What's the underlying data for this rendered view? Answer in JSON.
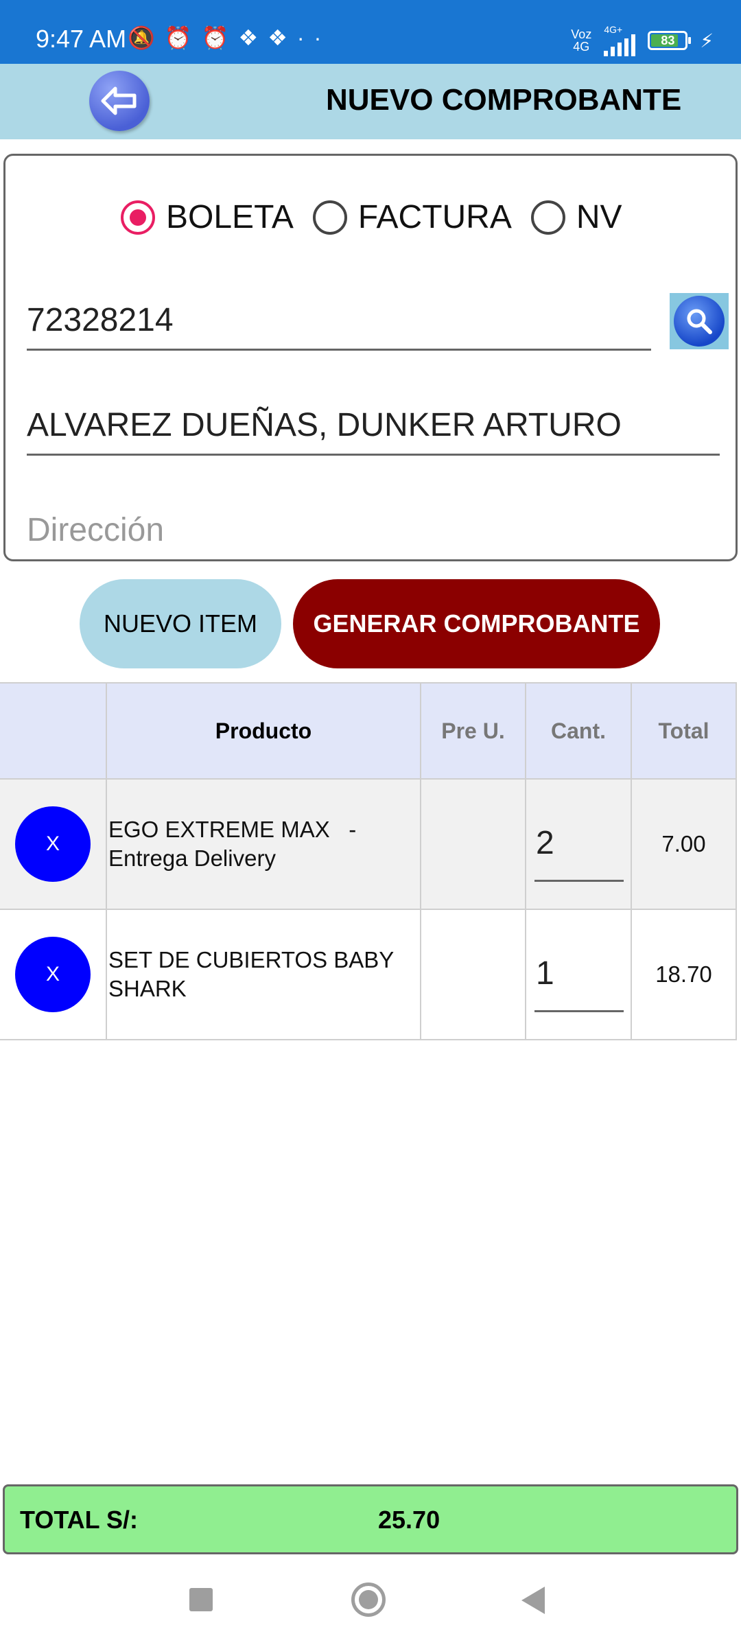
{
  "status_bar": {
    "time": "9:47 AM",
    "icons_left": [
      "mute-icon",
      "alarm-icon",
      "alarm-icon",
      "app-icon",
      "app-icon",
      "more-dots-icon"
    ],
    "network_top": "Voz",
    "network_bottom": "4G",
    "network_label": "4G+",
    "battery_level": "83",
    "battery_charging": true
  },
  "header": {
    "title": "NUEVO COMPROBANTE"
  },
  "form": {
    "radios": [
      {
        "label": "BOLETA",
        "checked": true
      },
      {
        "label": "FACTURA",
        "checked": false
      },
      {
        "label": "NV",
        "checked": false
      }
    ],
    "document_number": "72328214",
    "client_name": "ALVAREZ DUEÑAS, DUNKER ARTURO",
    "address_placeholder": "Dirección"
  },
  "actions": {
    "new_item": "NUEVO ITEM",
    "generate": "GENERAR COMPROBANTE"
  },
  "table": {
    "headers": [
      "",
      "Producto",
      "Pre U.",
      "Cant.",
      "Total"
    ],
    "rows": [
      {
        "delete": "X",
        "product": "EGO EXTREME MAX   - Entrega Delivery",
        "unit_price": "",
        "qty": "2",
        "total": "7.00"
      },
      {
        "delete": "X",
        "product": "SET DE CUBIERTOS BABY SHARK",
        "unit_price": "",
        "qty": "1",
        "total": "18.70"
      }
    ]
  },
  "total": {
    "label": "TOTAL S/:",
    "value": "25.70"
  },
  "colors": {
    "status_bar": "#1976d2",
    "header": "#add8e6",
    "radio_checked": "#e91e63",
    "generate_button": "#8b0000",
    "delete_button": "#0000ff",
    "total_bar": "#90ee90"
  }
}
